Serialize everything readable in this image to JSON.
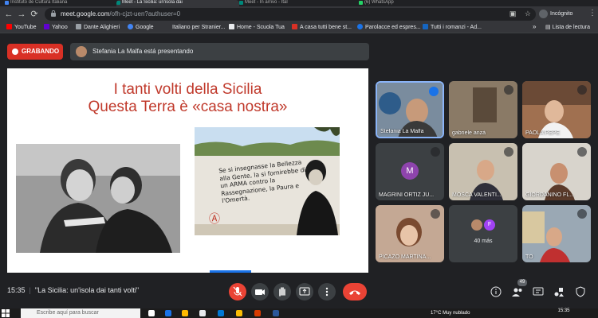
{
  "browser": {
    "tabs": [
      "Instituto de Cultura Italiana",
      "Meet - La Sicilia: un'isola dai",
      "Meet - In arrivo - Ital",
      "(6) WhatsApp"
    ],
    "url_host": "meet.google.com",
    "url_path": "/ofh-cjzt-uen?authuser=0",
    "profile_label": "Incógnito"
  },
  "bookmarks": {
    "items": [
      "YouTube",
      "Yahoo",
      "Dante Alighieri",
      "Google",
      "Italiano per Stranier...",
      "Home - Scuola Tua",
      "A casa tutti bene st...",
      "Parolacce ed espres...",
      "Tutti i romanzi - Ad..."
    ],
    "reading_list": "Lista de lectura"
  },
  "meet": {
    "recording_label": "GRABANDO",
    "presenting_text": "Stefania La Malfa está presentando",
    "time": "15:35",
    "meeting_title": "\"La Sicilia: un'isola dai tanti volti\"",
    "participant_count": "49",
    "more_count_label": "40 más"
  },
  "slide": {
    "title_line1": "I tanti volti della Sicilia",
    "title_line2": "Questa Terra è «casa nostra»",
    "mural_quote": "Se si insegnasse la Bellezza alla Gente, la si fornirebbe di un ARMA contro la Rassegnazione, la Paura e l'Omertà."
  },
  "participants": [
    {
      "name": "Stefania La Malfa"
    },
    {
      "name": "gabriele anzà"
    },
    {
      "name": "PAOLA PEPE"
    },
    {
      "name": "MAGRINI ORTIZ JU...",
      "initial": "M"
    },
    {
      "name": "MOSCA VALENTI..."
    },
    {
      "name": "GIORDANINO FL..."
    },
    {
      "name": "PICAZO MARTINA..."
    },
    {
      "name": "",
      "initial": "F"
    },
    {
      "name": "TO"
    }
  ],
  "taskbar": {
    "search_placeholder": "Escribe aquí para buscar",
    "weather": "17°C Muy nublado",
    "time": "15:35"
  },
  "colors": {
    "record_red": "#d93025",
    "hangup_red": "#ea4335",
    "slide_title_red": "#c0392b",
    "speaker_highlight": "#8ab4f8"
  }
}
